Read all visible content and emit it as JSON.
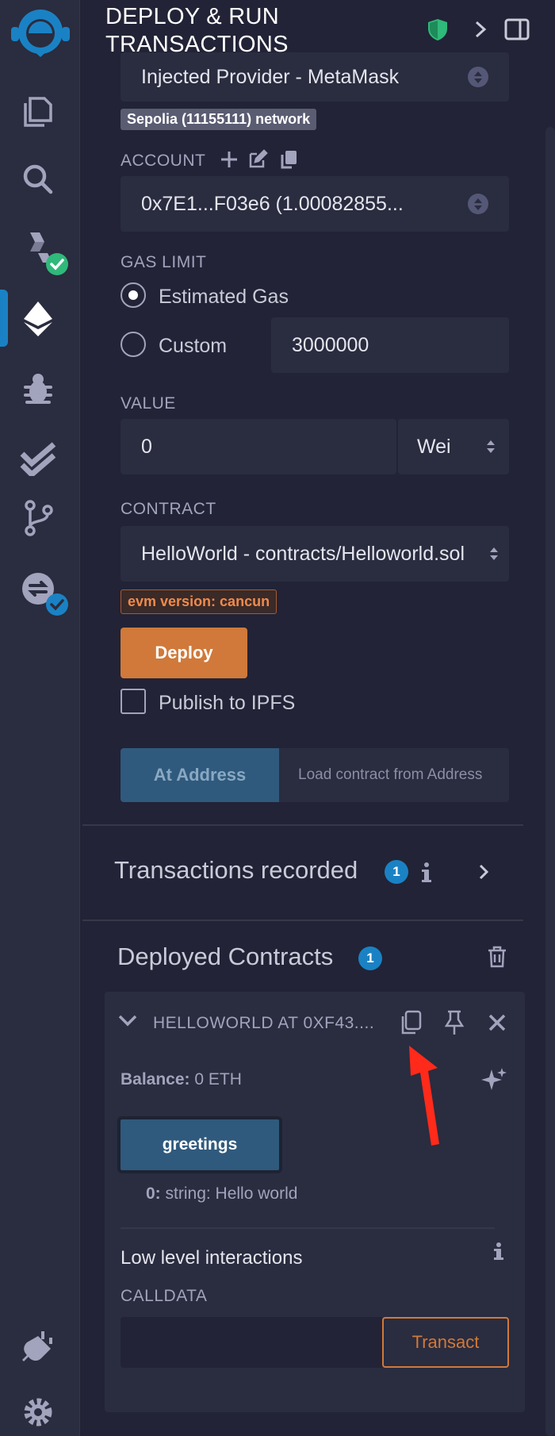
{
  "header": {
    "title_line1": "DEPLOY & RUN",
    "title_line2": "TRANSACTIONS"
  },
  "environment": {
    "value": "Injected Provider - MetaMask",
    "network_badge": "Sepolia (11155111) network"
  },
  "account": {
    "label": "ACCOUNT",
    "value": "0x7E1...F03e6 (1.00082855..."
  },
  "gas_limit": {
    "label": "GAS LIMIT",
    "estimated_label": "Estimated Gas",
    "custom_label": "Custom",
    "custom_value": "3000000",
    "selected": "Estimated Gas"
  },
  "value": {
    "label": "VALUE",
    "amount": "0",
    "unit": "Wei"
  },
  "contract": {
    "label": "CONTRACT",
    "value": "HelloWorld - contracts/Helloworld.sol",
    "evm_badge": "evm version: cancun"
  },
  "deploy": {
    "button": "Deploy",
    "publish_label": "Publish to IPFS"
  },
  "at_address": {
    "button": "At Address",
    "placeholder": "Load contract from Address"
  },
  "transactions": {
    "label": "Transactions recorded",
    "count": "1"
  },
  "deployed": {
    "label": "Deployed Contracts",
    "count": "1",
    "instance": {
      "title": "HELLOWORLD AT 0XF43....",
      "balance_label": "Balance:",
      "balance_value": "0 ETH",
      "function_button": "greetings",
      "output_index": "0:",
      "output_value": "string: Hello world"
    },
    "low_level": {
      "title": "Low level interactions",
      "calldata_label": "CALLDATA",
      "transact_button": "Transact"
    }
  },
  "colors": {
    "accent": "#1a82c4",
    "deploy": "#d0793a",
    "success": "#2fb97a",
    "arrow": "#ff2a1a"
  }
}
